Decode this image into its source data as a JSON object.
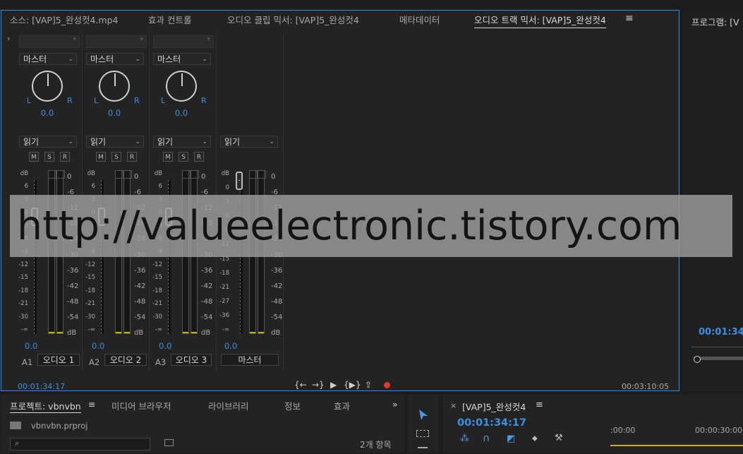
{
  "tabs": {
    "source": "소스: [VAP]5_완성컷4.mp4",
    "effect_controls": "효과 컨트롤",
    "audio_clip_mixer": "오디오 클립 믹서: [VAP]5_완성컷4",
    "metadata": "메타데이터",
    "audio_track_mixer": "오디오 트랙 믹서: [VAP]5_완성컷4",
    "menu": "≡"
  },
  "strips": [
    {
      "output": "마스터",
      "pan_l": "L",
      "pan_r": "R",
      "pan_value": "0.0",
      "automation": "읽기",
      "m": "M",
      "s": "S",
      "r": "R",
      "volume": "0.0",
      "track_id": "A1",
      "track_name": "오디오 1"
    },
    {
      "output": "마스터",
      "pan_l": "L",
      "pan_r": "R",
      "pan_value": "0.0",
      "automation": "읽기",
      "m": "M",
      "s": "S",
      "r": "R",
      "volume": "0.0",
      "track_id": "A2",
      "track_name": "오디오 2"
    },
    {
      "output": "마스터",
      "pan_l": "L",
      "pan_r": "R",
      "pan_value": "0.0",
      "automation": "읽기",
      "m": "M",
      "s": "S",
      "r": "R",
      "volume": "0.0",
      "track_id": "A3",
      "track_name": "오디오 3"
    }
  ],
  "master_strip": {
    "automation": "읽기",
    "volume": "0.0",
    "track_name": "마스터"
  },
  "scale_left": [
    "dB",
    "6",
    "3",
    "0",
    "-3",
    "-6",
    "-9",
    "-12",
    "-15",
    "-18",
    "-21",
    "-30",
    "-∞"
  ],
  "scale_left_master": [
    "dB",
    "0",
    "-3",
    "-6",
    "-9",
    "-12",
    "-15",
    "-18",
    "-21",
    "-27",
    "-36",
    "-∞"
  ],
  "scale_right": [
    "0",
    "-6",
    "-12",
    "-18",
    "-24",
    "-30",
    "-36",
    "-42",
    "-48",
    "-54",
    "dB"
  ],
  "timecode_current": "00:01:34:17",
  "timecode_total": "00:03:10:05",
  "transport": {
    "in_out": "{←",
    "step": "→}",
    "play": "▶",
    "loop": "{▶}",
    "export": "⇪"
  },
  "program": {
    "title": "프로그램: [V",
    "timecode": "00:01:34:"
  },
  "project": {
    "tab_project": "프로젝트: vbnvbn",
    "menu": "≡",
    "tab_media": "미디어 브라우저",
    "tab_library": "라이브러리",
    "tab_info": "정보",
    "tab_effects": "효과",
    "more": "»",
    "file": "vbnvbn.prproj",
    "items": "2개 항목"
  },
  "timeline": {
    "close": "×",
    "title": "[VAP]5_완성컷4",
    "menu": "≡",
    "timecode": "00:01:34:17",
    "ruler": [
      ":00:00",
      "00:00:30:00"
    ]
  },
  "watermark": "http://valueelectronic.tistory.com",
  "colors": {
    "accent": "#2d8ceb",
    "value_blue": "#3d8fe0",
    "record": "#e23636"
  }
}
